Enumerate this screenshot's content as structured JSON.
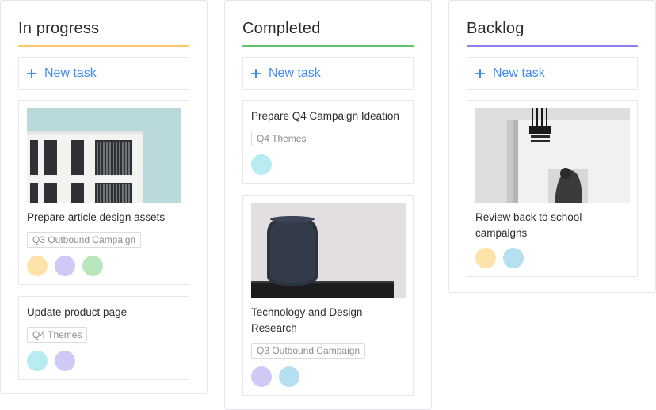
{
  "columns": [
    {
      "title": "In progress",
      "accent": "#f8c86a",
      "new_task_label": "New task",
      "cards": [
        {
          "title": "Prepare article design assets",
          "tag": "Q3 Outbound Campaign",
          "image": "building-photo",
          "avatars": [
            "#fde3a8",
            "#cfc9f6",
            "#b9e6bd"
          ]
        },
        {
          "title": "Update product page",
          "tag": "Q4 Themes",
          "avatars": [
            "#b7ecf2",
            "#cfc9f6"
          ]
        }
      ]
    },
    {
      "title": "Completed",
      "accent": "#5fc36c",
      "new_task_label": "New task",
      "cards": [
        {
          "title": "Prepare Q4 Campaign Ideation",
          "tag": "Q4 Themes",
          "avatars": [
            "#b7ecf2"
          ]
        },
        {
          "title": "Technology and Design Research",
          "tag": "Q3 Outbound Campaign",
          "image": "smart-speaker-photo",
          "avatars": [
            "#cfc9f6",
            "#b6e0f0"
          ]
        }
      ]
    },
    {
      "title": "Backlog",
      "accent": "#8b7ef0",
      "new_task_label": "New task",
      "cards": [
        {
          "title": "Review back to school campaigns",
          "image": "magazine-photo",
          "avatars": [
            "#fde3a8",
            "#b6e0f0"
          ]
        }
      ]
    }
  ]
}
